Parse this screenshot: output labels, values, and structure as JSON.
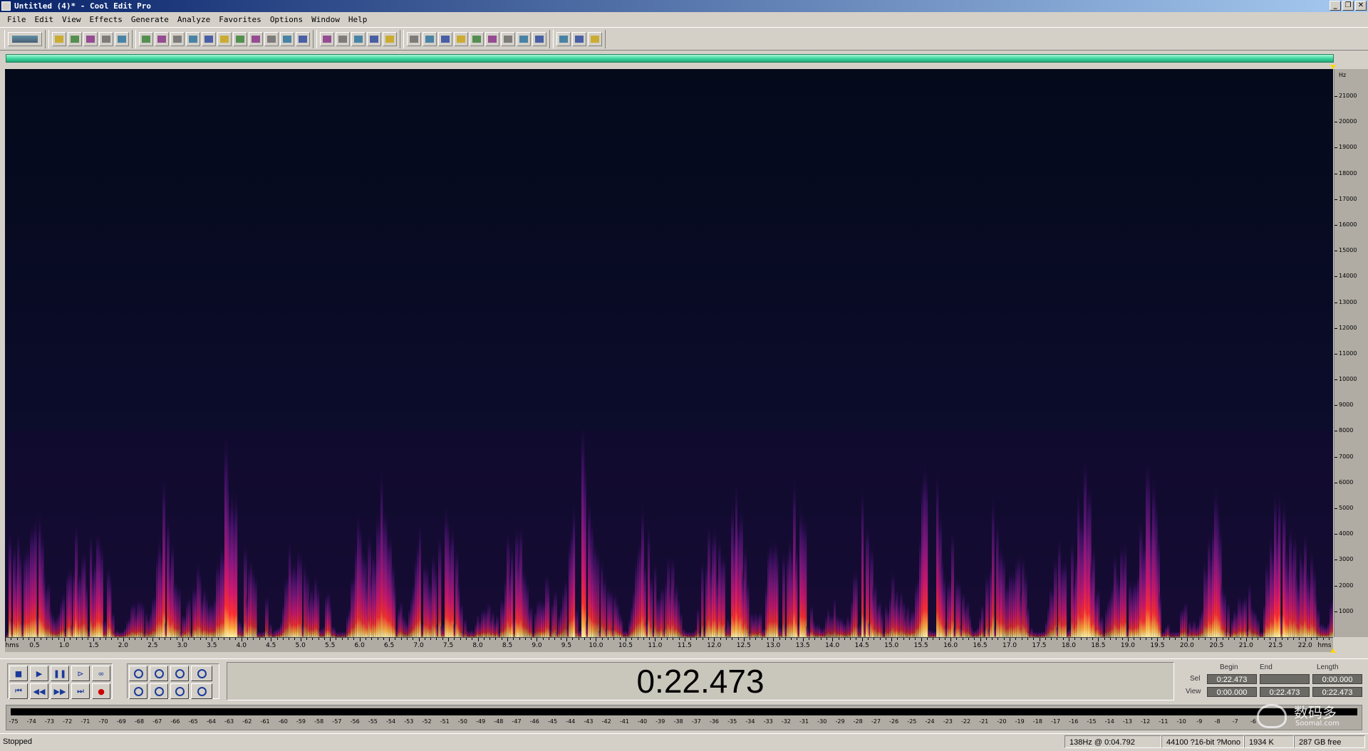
{
  "window": {
    "title": "Untitled (4)* - Cool Edit Pro",
    "buttons": [
      "_",
      "❐",
      "✕"
    ]
  },
  "menu": [
    "File",
    "Edit",
    "View",
    "Effects",
    "Generate",
    "Analyze",
    "Favorites",
    "Options",
    "Window",
    "Help"
  ],
  "toolbar": {
    "groups": [
      [
        "multitrack-toggle-icon"
      ],
      [
        "new-file-icon",
        "open-file-icon",
        "save-icon",
        "save-all-icon",
        "save-selection-icon"
      ],
      [
        "undo-icon",
        "redo-icon",
        "repeat-icon",
        "copy-icon",
        "copy-new-icon",
        "cut-icon",
        "paste-icon",
        "paste-new-icon",
        "mix-paste-icon",
        "trim-icon",
        "play-selection-icon"
      ],
      [
        "draw-tool-icon",
        "envelope-icon",
        "grid-icon",
        "grid2-icon",
        "grid3-icon"
      ],
      [
        "waveform-view-icon",
        "spectral-view-icon",
        "spectral-alt-icon",
        "play-list-icon",
        "zoom-window-icon",
        "time-format-icon",
        "snap-icon",
        "cue-list-icon",
        "hscroll-icon"
      ],
      [
        "settings-icon",
        "edit-icon",
        "help-icon"
      ]
    ]
  },
  "spectrogram": {
    "frequency_unit": "Hz",
    "frequency_labels": [
      "21000",
      "20000",
      "19000",
      "18000",
      "17000",
      "16000",
      "15000",
      "14000",
      "13000",
      "12000",
      "11000",
      "10000",
      "9000",
      "8000",
      "7000",
      "6000",
      "5000",
      "4000",
      "3000",
      "2000",
      "1000"
    ],
    "time_unit": "hms",
    "time_labels": [
      "0.5",
      "1.0",
      "1.5",
      "2.0",
      "2.5",
      "3.0",
      "3.5",
      "4.0",
      "4.5",
      "5.0",
      "5.5",
      "6.0",
      "6.5",
      "7.0",
      "7.5",
      "8.0",
      "8.5",
      "9.0",
      "9.5",
      "10.0",
      "10.5",
      "11.0",
      "11.5",
      "12.0",
      "12.5",
      "13.0",
      "13.5",
      "14.0",
      "14.5",
      "15.0",
      "15.5",
      "16.0",
      "16.5",
      "17.0",
      "17.5",
      "18.0",
      "18.5",
      "19.0",
      "19.5",
      "20.0",
      "20.5",
      "21.0",
      "21.5",
      "22.0"
    ],
    "duration_seconds": 22.473,
    "max_frequency_hz": 22050,
    "background_color": "#050a1c"
  },
  "transport": {
    "row1": [
      "stop-icon",
      "play-icon",
      "pause-icon",
      "play-to-end-icon",
      "loop-icon"
    ],
    "row2": [
      "go-to-start-icon",
      "rewind-icon",
      "fast-forward-icon",
      "go-to-end-icon",
      "record-icon"
    ],
    "glyphs": {
      "stop-icon": "■",
      "play-icon": "▶",
      "pause-icon": "❚❚",
      "play-to-end-icon": "⊳",
      "loop-icon": "∞",
      "go-to-start-icon": "⏮",
      "rewind-icon": "◀◀",
      "fast-forward-icon": "▶▶",
      "go-to-end-icon": "⏭",
      "record-icon": "●"
    }
  },
  "zoom": {
    "row1": [
      "zoom-in-icon",
      "zoom-out-icon",
      "zoom-full-icon",
      "zoom-in-vertical-icon"
    ],
    "row2": [
      "zoom-left-icon",
      "zoom-right-icon",
      "zoom-selection-icon",
      "zoom-out-vertical-icon"
    ]
  },
  "time_display": "0:22.473",
  "selection": {
    "headers": {
      "begin": "Begin",
      "end": "End",
      "length": "Length"
    },
    "sel_label": "Sel",
    "view_label": "View",
    "sel": {
      "begin": "0:22.473",
      "end": "",
      "length": "0:00.000"
    },
    "view": {
      "begin": "0:00.000",
      "end": "0:22.473",
      "length": "0:22.473"
    }
  },
  "level_meter": {
    "labels": [
      "-75",
      "-74",
      "-73",
      "-72",
      "-71",
      "-70",
      "-69",
      "-68",
      "-67",
      "-66",
      "-65",
      "-64",
      "-63",
      "-62",
      "-61",
      "-60",
      "-59",
      "-58",
      "-57",
      "-56",
      "-55",
      "-54",
      "-53",
      "-52",
      "-51",
      "-50",
      "-49",
      "-48",
      "-47",
      "-46",
      "-45",
      "-44",
      "-43",
      "-42",
      "-41",
      "-40",
      "-39",
      "-38",
      "-37",
      "-36",
      "-35",
      "-34",
      "-33",
      "-32",
      "-31",
      "-30",
      "-29",
      "-28",
      "-27",
      "-26",
      "-25",
      "-24",
      "-23",
      "-22",
      "-21",
      "-20",
      "-19",
      "-18",
      "-17",
      "-16",
      "-15",
      "-14",
      "-13",
      "-12",
      "-11",
      "-10",
      "-9",
      "-8",
      "-7",
      "-6"
    ]
  },
  "status": {
    "state": "Stopped",
    "cursor": "138Hz @  0:04.792",
    "format": "44100 ?16-bit ?Mono",
    "size": "1934 K",
    "free": "287 GB free"
  },
  "watermark": {
    "text": "数码多",
    "sub": "Soomal.com"
  }
}
